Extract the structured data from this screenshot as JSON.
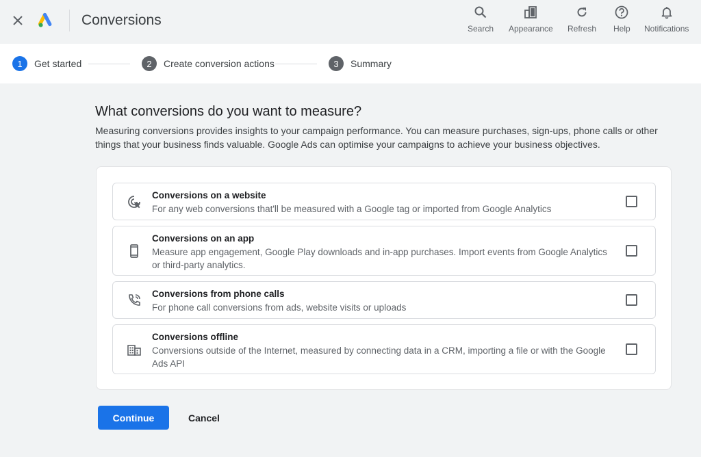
{
  "header": {
    "title": "Conversions",
    "tools": [
      {
        "label": "Search",
        "icon": "search-icon"
      },
      {
        "label": "Appearance",
        "icon": "appearance-icon"
      },
      {
        "label": "Refresh",
        "icon": "refresh-icon"
      },
      {
        "label": "Help",
        "icon": "help-icon"
      },
      {
        "label": "Notifications",
        "icon": "bell-icon"
      }
    ]
  },
  "stepper": {
    "steps": [
      {
        "num": "1",
        "label": "Get started",
        "state": "active"
      },
      {
        "num": "2",
        "label": "Create conversion actions",
        "state": "inactive"
      },
      {
        "num": "3",
        "label": "Summary",
        "state": "inactive"
      }
    ]
  },
  "main": {
    "heading": "What conversions do you want to measure?",
    "description": "Measuring conversions provides insights to your campaign performance. You can measure purchases, sign-ups, phone calls or other things that your business finds valuable. Google Ads can optimise your campaigns to achieve your business objectives.",
    "options": [
      {
        "title": "Conversions on a website",
        "text": "For any web conversions that'll be measured with a Google tag or imported from Google Analytics",
        "icon": "cursor-click-icon",
        "checked": false
      },
      {
        "title": "Conversions on an app",
        "text": "Measure app engagement, Google Play downloads and in-app purchases. Import events from Google Analytics or third-party analytics.",
        "icon": "phone-icon",
        "checked": false
      },
      {
        "title": "Conversions from phone calls",
        "text": "For phone call conversions from ads, website visits or uploads",
        "icon": "phone-call-icon",
        "checked": false
      },
      {
        "title": "Conversions offline",
        "text": "Conversions outside of the Internet, measured by connecting data in a CRM, importing a file or with the Google Ads API",
        "icon": "building-icon",
        "checked": false
      }
    ]
  },
  "actions": {
    "continue_label": "Continue",
    "cancel_label": "Cancel"
  },
  "colors": {
    "accent": "#1a73e8",
    "background": "#f1f3f4"
  }
}
